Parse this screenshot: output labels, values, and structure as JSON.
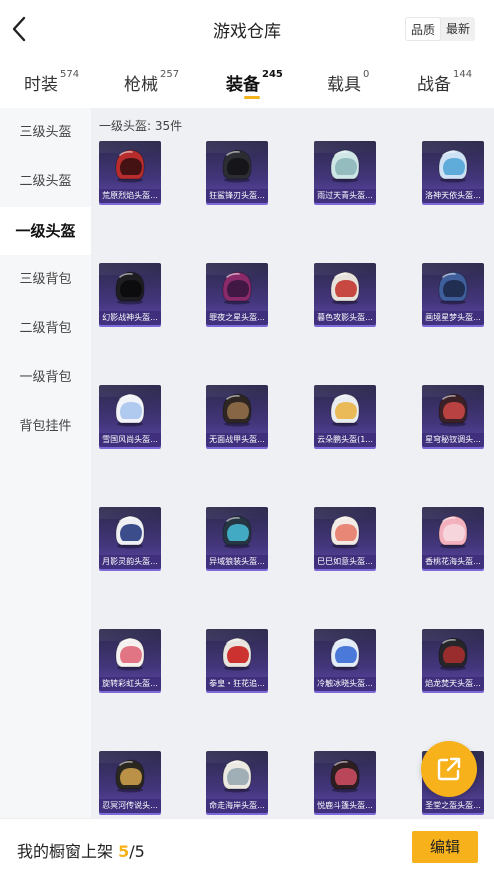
{
  "header": {
    "title": "游戏仓库",
    "sort_quality": "品质",
    "sort_latest": "最新"
  },
  "tabs": [
    {
      "label": "时装",
      "count": "574"
    },
    {
      "label": "枪械",
      "count": "257"
    },
    {
      "label": "装备",
      "count": "245",
      "active": true
    },
    {
      "label": "载具",
      "count": "0"
    },
    {
      "label": "战备",
      "count": "144"
    }
  ],
  "sidebar": {
    "items": [
      {
        "label": "三级头盔"
      },
      {
        "label": "二级头盔"
      },
      {
        "label": "一级头盔",
        "active": true
      },
      {
        "label": "三级背包"
      },
      {
        "label": "二级背包"
      },
      {
        "label": "一级背包"
      },
      {
        "label": "背包挂件"
      }
    ]
  },
  "content": {
    "count_label": "一级头盔: 35件"
  },
  "items": [
    {
      "name": "荒原烈焰头盔...",
      "shell": "#b72c2c",
      "visor": "#3a1010"
    },
    {
      "name": "狂鲨锋刃头盔...",
      "shell": "#2b2d33",
      "visor": "#141418"
    },
    {
      "name": "雨过天青头盔...",
      "shell": "#cfe6e6",
      "visor": "#8fb7ba"
    },
    {
      "name": "洛神天依头盔...",
      "shell": "#cfe1f5",
      "visor": "#56a7d8"
    },
    {
      "name": "幻影战神头盔...",
      "shell": "#1d1d22",
      "visor": "#0b0b0e"
    },
    {
      "name": "罪夜之星头盔...",
      "shell": "#8b2a6a",
      "visor": "#3b1740"
    },
    {
      "name": "暮色攻影头盔...",
      "shell": "#e8e2dc",
      "visor": "#c23b33"
    },
    {
      "name": "画境星梦头盔...",
      "shell": "#3f5f9c",
      "visor": "#1c2a4b"
    },
    {
      "name": "雪国风尚头盔...",
      "shell": "#f1f3f8",
      "visor": "#a9c5ee"
    },
    {
      "name": "无面战甲头盔...",
      "shell": "#2e2622",
      "visor": "#8f6b49"
    },
    {
      "name": "云朵鹏头盔(1...",
      "shell": "#e8edf2",
      "visor": "#e8b54a"
    },
    {
      "name": "星穹秘钗调头...",
      "shell": "#3b2026",
      "visor": "#c34544"
    },
    {
      "name": "月影灵韵头盔...",
      "shell": "#eef0f4",
      "visor": "#2c3f82"
    },
    {
      "name": "异域狼装头盔...",
      "shell": "#253542",
      "visor": "#45b4cf"
    },
    {
      "name": "巳巳如意头盔...",
      "shell": "#f3ebe6",
      "visor": "#e87e6e"
    },
    {
      "name": "香桃花海头盔...",
      "shell": "#f2b1bd",
      "visor": "#f6d9de"
    },
    {
      "name": "旋转彩虹头盔...",
      "shell": "#f5f1ee",
      "visor": "#e06a7b"
    },
    {
      "name": "拳皇・狂花追...",
      "shell": "#e9e4e0",
      "visor": "#c92421"
    },
    {
      "name": "冷触冰晓头盔...",
      "shell": "#e3ecf7",
      "visor": "#3e6fd6"
    },
    {
      "name": "焰龙焚天头盔...",
      "shell": "#26262a",
      "visor": "#a32c2c"
    },
    {
      "name": "忍冥河传说头...",
      "shell": "#2a2620",
      "visor": "#c79a4a"
    },
    {
      "name": "命走海岸头盔...",
      "shell": "#ece8e2",
      "visor": "#99a9b1"
    },
    {
      "name": "悦鹿斗篷头盔...",
      "shell": "#2d1e22",
      "visor": "#c74b5e"
    },
    {
      "name": "圣堂之盔头盔...",
      "shell": "#3a3a50",
      "visor": "#8e86c8"
    }
  ],
  "bottom": {
    "shelf_label": "我的橱窗上架",
    "shelf_current": "5",
    "shelf_total": "/5",
    "edit_label": "编辑"
  },
  "colors": {
    "accent": "#f6b11b",
    "card_bg": "#43357a"
  }
}
